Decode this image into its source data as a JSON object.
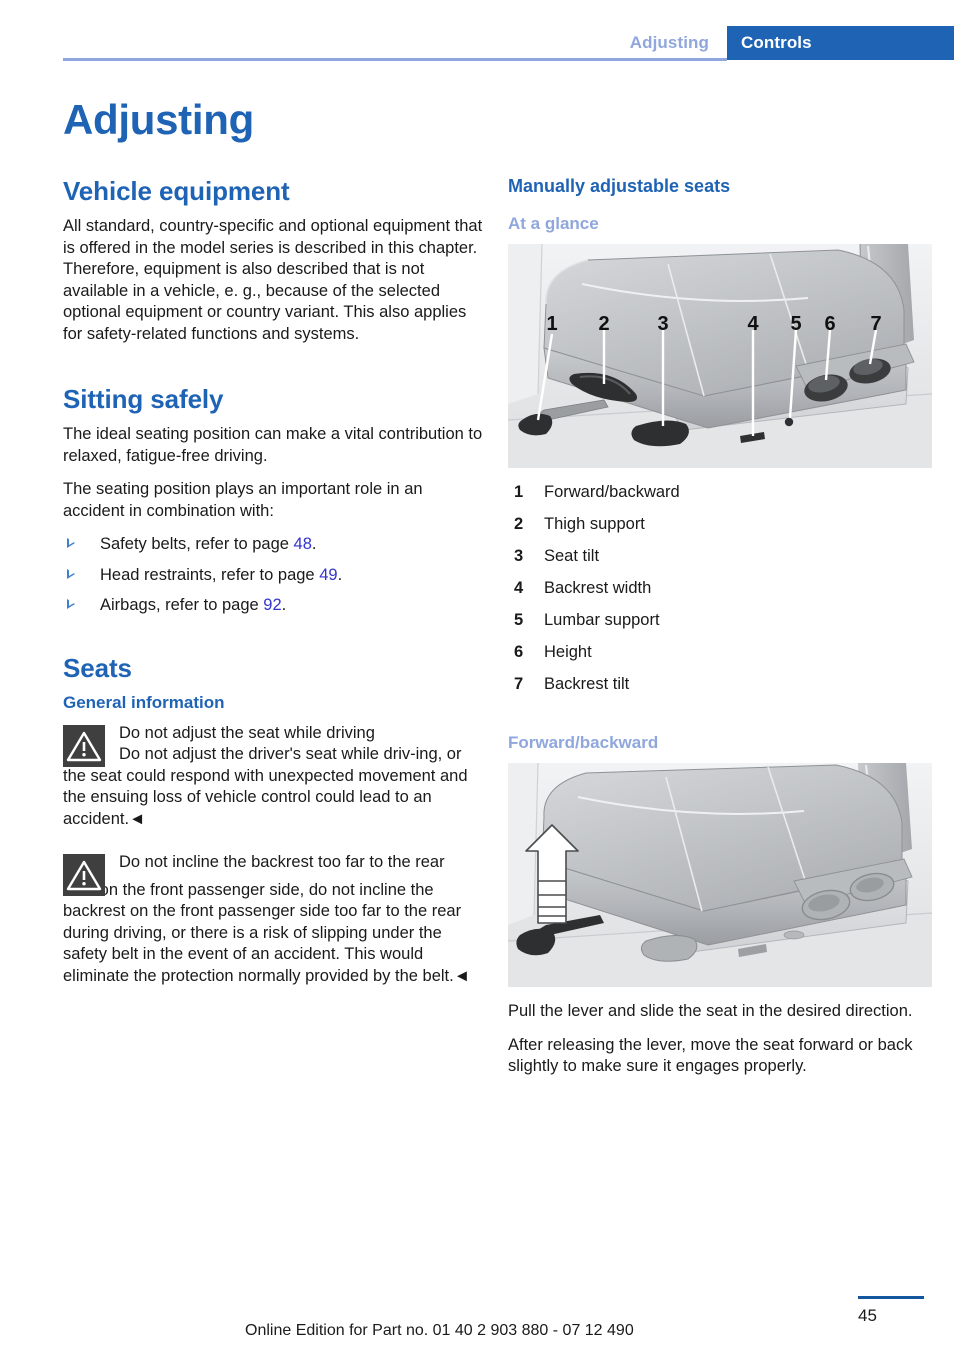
{
  "header": {
    "tab_inactive": "Adjusting",
    "tab_active": "Controls",
    "accent_blue": "#1f63b5",
    "light_blue": "#8fa7dc"
  },
  "page_title": "Adjusting",
  "left_column": {
    "vehicle_equipment": {
      "heading": "Vehicle equipment",
      "paragraph": "All standard, country-specific and optional equipment that is offered in the model series is described in this chapter. Therefore, equipment is also described that is not available in a vehicle, e. g., because of the selected optional equipment or country variant. This also applies for safety-related functions and systems."
    },
    "sitting_safely": {
      "heading": "Sitting safely",
      "paragraph_1": "The ideal seating position can make a vital contribution to relaxed, fatigue-free driving.",
      "paragraph_2": "The seating position plays an important role in an accident in combination with:",
      "bullets": [
        {
          "text_before": "Safety belts, refer to page ",
          "page_ref": "48",
          "text_after": "."
        },
        {
          "text_before": "Head restraints, refer to page ",
          "page_ref": "49",
          "text_after": "."
        },
        {
          "text_before": "Airbags, refer to page ",
          "page_ref": "92",
          "text_after": "."
        }
      ]
    },
    "seats": {
      "heading": "Seats",
      "subheading": "General information",
      "warnings": [
        {
          "icon": "warning-triangle-icon",
          "title": "Do not adjust the seat while driving",
          "body_first": "Do not adjust the driver's seat while driv-",
          "body_rest": "ing, or the seat could respond with unexpected movement and the ensuing loss of vehicle control could lead to an accident.◄"
        },
        {
          "icon": "warning-triangle-icon",
          "title": "Do not incline the backrest too far to the rear",
          "body_first": "",
          "body_rest": "Also on the front passenger side, do not incline the backrest on the front passenger side too far to the rear during driving, or there is a risk of slipping under the safety belt in the event of an accident. This would eliminate the protection normally provided by the belt.◄"
        }
      ]
    }
  },
  "right_column": {
    "heading": "Manually adjustable seats",
    "at_a_glance": {
      "subheading": "At a glance",
      "figure_name": "seat-controls-overview-illustration",
      "callouts": [
        "1",
        "2",
        "3",
        "4",
        "5",
        "6",
        "7"
      ],
      "legend": [
        {
          "num": "1",
          "label": "Forward/backward"
        },
        {
          "num": "2",
          "label": "Thigh support"
        },
        {
          "num": "3",
          "label": "Seat tilt"
        },
        {
          "num": "4",
          "label": "Backrest width"
        },
        {
          "num": "5",
          "label": "Lumbar support"
        },
        {
          "num": "6",
          "label": "Height"
        },
        {
          "num": "7",
          "label": "Backrest tilt"
        }
      ]
    },
    "forward_backward": {
      "subheading": "Forward/backward",
      "figure_name": "seat-forward-backward-lever-illustration",
      "paragraph_1": "Pull the lever and slide the seat in the desired direction.",
      "paragraph_2": "After releasing the lever, move the seat forward or back slightly to make sure it engages properly."
    }
  },
  "footer": {
    "note": "Online Edition for Part no. 01 40 2 903 880 - 07 12 490",
    "page_number": "45"
  }
}
